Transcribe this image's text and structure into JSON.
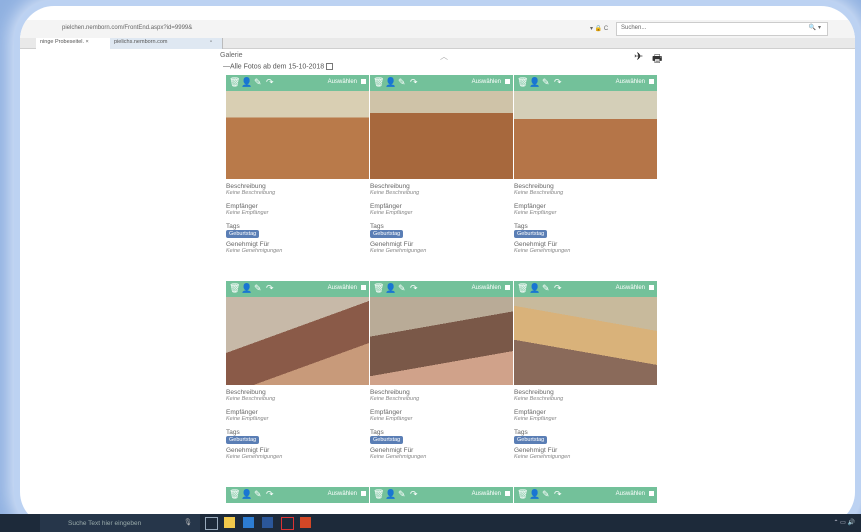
{
  "browser": {
    "url": "pielchen.nemborn.com/FrontEnd.aspx?id=9999&",
    "url_controls": "▾ 🔒 C",
    "search_placeholder": "Suchen...",
    "search_icon": "🔍 ▾",
    "tabs": [
      {
        "label": "ninge Probeseitel. ×"
      },
      {
        "label": "pielichs.nemborn.com"
      },
      {
        "label": "▫"
      }
    ]
  },
  "app": {
    "title": "Galerie",
    "collapse_icon": "chevron-up-icon",
    "actions": [
      {
        "name": "share-icon",
        "glyph": "✈"
      },
      {
        "name": "print-icon",
        "glyph": "🖶"
      }
    ]
  },
  "filter": {
    "label": "—Alle Fotos ab dem 15-10-2018"
  },
  "card_labels": {
    "select": "Auswählen",
    "description_label": "Beschreibung",
    "description_value": "Keine Beschreibung",
    "recipients_label": "Empfänger",
    "recipients_value": "Keine Empfänger",
    "tags_label": "Tags",
    "approved_label": "Genehmigt Für",
    "approved_value": "Keine Genehmigungen"
  },
  "cards": [
    {
      "tag": "Geburtstag"
    },
    {
      "tag": "Geburtstag"
    },
    {
      "tag": "Geburtstag"
    },
    {
      "tag": "Geburtstag"
    },
    {
      "tag": "Geburtstag"
    },
    {
      "tag": "Geburtstag"
    }
  ],
  "toolbar_icons": [
    "trash-icon",
    "person-icon",
    "pencil-icon",
    "share-arrow-icon"
  ],
  "taskbar": {
    "search_text": "Suche Text hier eingeben",
    "mic_icon": "🎙"
  },
  "colors": {
    "accent": "#73c19a",
    "tag": "#5a7eb5",
    "frame": "#8fb0e0"
  }
}
